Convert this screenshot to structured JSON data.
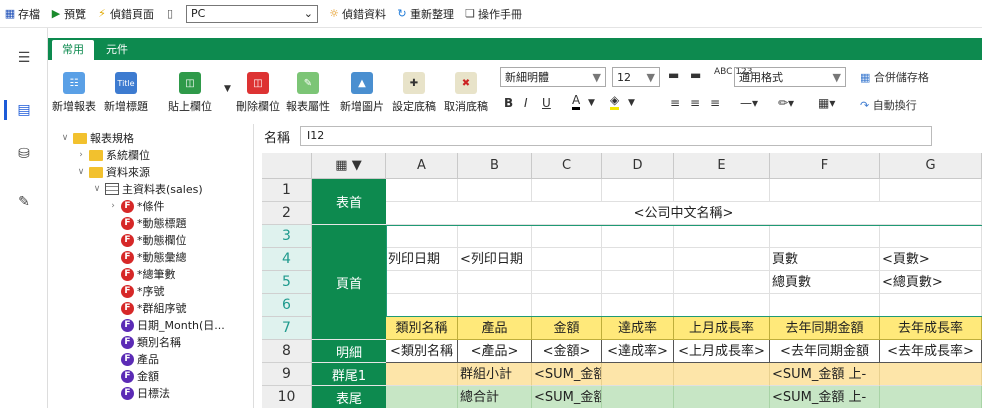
{
  "toolbar": {
    "save": "存檔",
    "preview": "預覽",
    "debug_page": "偵錯頁面",
    "device": "PC",
    "debug_data": "偵錯資料",
    "reorganize": "重新整理",
    "manual": "操作手冊"
  },
  "ribbon": {
    "tabs": [
      "常用",
      "元件"
    ],
    "buttons": [
      "新增報表",
      "新增標題",
      "貼上欄位",
      "刪除欄位",
      "報表屬性",
      "新增圖片",
      "設定底稿",
      "取消底稿"
    ],
    "title_icon_text": "Title",
    "font_name": "新細明體",
    "font_size": "12",
    "number_format": "通用格式",
    "format_icon_text": "ABC 123",
    "merge_cells": "合併儲存格",
    "wrap_text": "自動換行",
    "bold": "B",
    "italic": "I",
    "underline": "U",
    "font_color": "A"
  },
  "name_box": {
    "label": "名稱",
    "value": "I12"
  },
  "tree": [
    {
      "label": "報表規格",
      "icon": "folder",
      "depth": 0,
      "caret": "v"
    },
    {
      "label": "系統欄位",
      "icon": "folder-yellow",
      "depth": 1,
      "caret": ">"
    },
    {
      "label": "資料來源",
      "icon": "folder-yellow",
      "depth": 1,
      "caret": "v"
    },
    {
      "label": "主資料表(sales)",
      "icon": "table",
      "depth": 2,
      "caret": "v"
    },
    {
      "label": "*條件",
      "icon": "F-red",
      "depth": 3,
      "caret": ">"
    },
    {
      "label": "*動態標題",
      "icon": "F-red",
      "depth": 3,
      "caret": ""
    },
    {
      "label": "*動態欄位",
      "icon": "F-red",
      "depth": 3,
      "caret": ""
    },
    {
      "label": "*動態彙總",
      "icon": "F-red",
      "depth": 3,
      "caret": ""
    },
    {
      "label": "*總筆數",
      "icon": "F-red",
      "depth": 3,
      "caret": ""
    },
    {
      "label": "*序號",
      "icon": "F-red",
      "depth": 3,
      "caret": ""
    },
    {
      "label": "*群組序號",
      "icon": "F-red",
      "depth": 3,
      "caret": ""
    },
    {
      "label": "日期_Month(日...",
      "icon": "F-purple",
      "depth": 3,
      "caret": ""
    },
    {
      "label": "類別名稱",
      "icon": "F-purple",
      "depth": 3,
      "caret": ""
    },
    {
      "label": "產品",
      "icon": "F-purple",
      "depth": 3,
      "caret": ""
    },
    {
      "label": "金額",
      "icon": "F-purple",
      "depth": 3,
      "caret": ""
    },
    {
      "label": "日標法",
      "icon": "F-purple",
      "depth": 3,
      "caret": ""
    }
  ],
  "sheet": {
    "columns": [
      "A",
      "B",
      "C",
      "D",
      "E",
      "F",
      "G"
    ],
    "rows": [
      "1",
      "2",
      "3",
      "4",
      "5",
      "6",
      "7",
      "8",
      "9",
      "10"
    ],
    "bands": {
      "header": "表首",
      "page_header": "頁首",
      "detail": "明細",
      "group_footer": "群尾1",
      "footer": "表尾"
    },
    "company_name": "<公司中文名稱>",
    "print_date_label": "列印日期",
    "print_date_value": "<列印日期",
    "page_label": "頁數",
    "page_value": "<頁數>",
    "total_pages_label": "總頁數",
    "total_pages_value": "<總頁數>",
    "header_row": [
      "類別名稱",
      "產品",
      "金額",
      "達成率",
      "上月成長率",
      "去年同期金額",
      "去年成長率"
    ],
    "detail_row": [
      "<類別名稱",
      "<產品>",
      "<金額>",
      "<達成率>",
      "<上月成長率>",
      "<去年同期金額",
      "<去年成長率>"
    ],
    "group_row": [
      "",
      "群組小計",
      "<SUM_金額",
      "",
      "",
      "<SUM_金額 上-",
      ""
    ],
    "total_row": [
      "",
      "總合計",
      "<SUM_金額",
      "",
      "",
      "<SUM_金額 上-",
      ""
    ]
  }
}
